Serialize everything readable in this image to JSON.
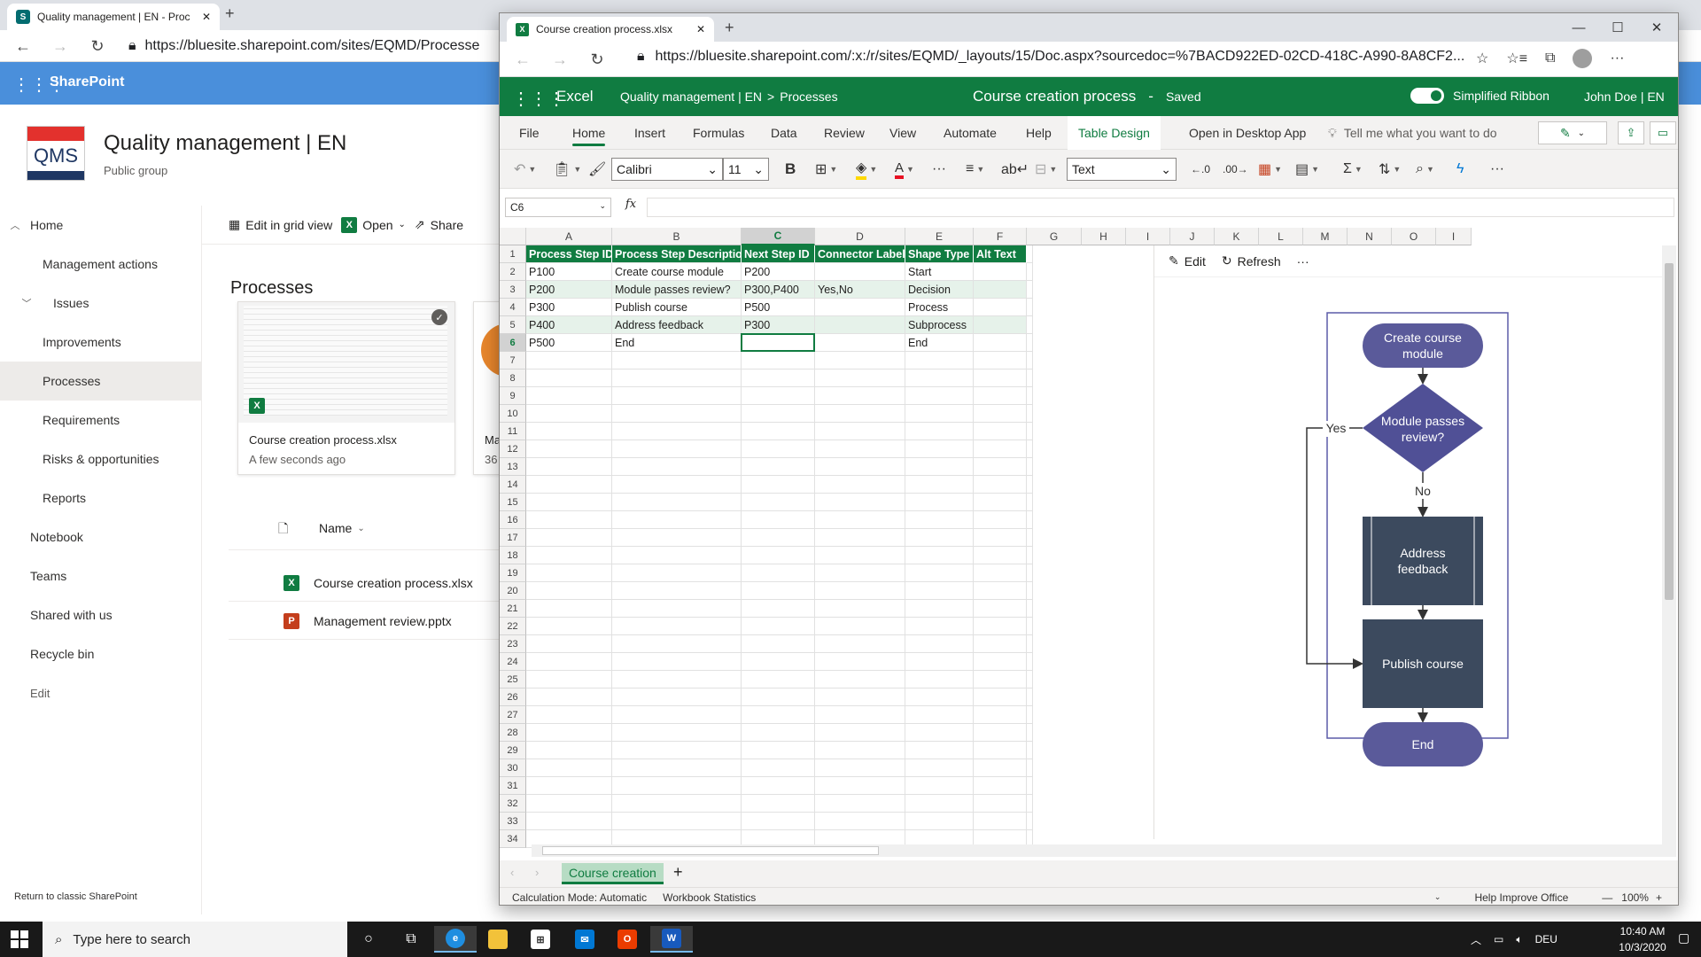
{
  "bg_browser": {
    "tab_title": "Quality management | EN - Proc",
    "url": "https://bluesite.sharepoint.com/sites/EQMD/Processe"
  },
  "sharepoint": {
    "brand": "SharePoint",
    "logo_text": "QMS",
    "site_title": "Quality management | EN",
    "site_subtitle": "Public group",
    "nav": [
      {
        "label": "Home"
      },
      {
        "label": "Management actions"
      },
      {
        "label": "Issues"
      },
      {
        "label": "Improvements"
      },
      {
        "label": "Processes"
      },
      {
        "label": "Requirements"
      },
      {
        "label": "Risks & opportunities"
      },
      {
        "label": "Reports"
      },
      {
        "label": "Notebook"
      },
      {
        "label": "Teams"
      },
      {
        "label": "Shared with us"
      },
      {
        "label": "Recycle bin"
      },
      {
        "label": "Edit"
      }
    ],
    "return_link": "Return to classic SharePoint",
    "commands": {
      "grid": "Edit in grid view",
      "open": "Open",
      "share": "Share"
    },
    "library_title": "Processes",
    "card1": {
      "name": "Course creation process.xlsx",
      "meta": "A few seconds ago"
    },
    "card2": {
      "name": "Ma",
      "meta": "36"
    },
    "list_header": "Name",
    "files": [
      {
        "name": "Course creation process.xlsx"
      },
      {
        "name": "Management review.pptx"
      }
    ]
  },
  "excel_browser": {
    "tab_title": "Course creation process.xlsx",
    "url": "https://bluesite.sharepoint.com/:x:/r/sites/EQMD/_layouts/15/Doc.aspx?sourcedoc=%7BACD922ED-02CD-418C-A990-8A8CF2..."
  },
  "excel": {
    "app": "Excel",
    "breadcrumb_site": "Quality management | EN",
    "breadcrumb_sep": ">",
    "breadcrumb_folder": "Processes",
    "doc_title": "Course creation process",
    "doc_sep": "-",
    "doc_status": "Saved",
    "simplified_ribbon": "Simplified Ribbon",
    "user": "John Doe | EN",
    "menu": {
      "file": "File",
      "home": "Home",
      "insert": "Insert",
      "formulas": "Formulas",
      "data": "Data",
      "review": "Review",
      "view": "View",
      "automate": "Automate",
      "help": "Help",
      "table_design": "Table Design",
      "open_desktop": "Open in Desktop App",
      "tell_me": "Tell me what you want to do"
    },
    "ribbon": {
      "font": "Calibri",
      "size": "11",
      "format": "Text"
    },
    "name_box": "C6",
    "fx": "fx",
    "columns": [
      "A",
      "B",
      "C",
      "D",
      "E",
      "F",
      "G",
      "H",
      "I",
      "J",
      "K",
      "L",
      "M",
      "N",
      "O",
      "I"
    ],
    "selected_column": "C",
    "selected_row": "6",
    "rows": [
      "1",
      "2",
      "3",
      "4",
      "5",
      "6",
      "7",
      "8",
      "9",
      "10",
      "11",
      "12",
      "13",
      "14",
      "15",
      "16",
      "17",
      "18",
      "19",
      "20",
      "21",
      "22",
      "23",
      "24",
      "25",
      "26",
      "27",
      "28",
      "29",
      "30",
      "31",
      "32",
      "33",
      "34"
    ],
    "table": {
      "headers": [
        "Process Step ID",
        "Process Step Description",
        "Next Step ID",
        "Connector Label",
        "Shape Type",
        "Alt Text"
      ],
      "rows": [
        [
          "P100",
          "Create course module",
          "P200",
          "",
          "Start",
          ""
        ],
        [
          "P200",
          "Module passes review?",
          "P300,P400",
          "Yes,No",
          "Decision",
          ""
        ],
        [
          "P300",
          "Publish course",
          "P500",
          "",
          "Process",
          ""
        ],
        [
          "P400",
          "Address feedback",
          "P300",
          "",
          "Subprocess",
          ""
        ],
        [
          "P500",
          "End",
          "",
          "",
          "End",
          ""
        ]
      ]
    },
    "pane": {
      "edit": "Edit",
      "refresh": "Refresh",
      "more": "···"
    },
    "diagram": {
      "start": [
        "Create course",
        "module"
      ],
      "decision": [
        "Module passes",
        "review?"
      ],
      "subprocess": [
        "Address",
        "feedback"
      ],
      "process": "Publish course",
      "end": "End",
      "label_yes": "Yes",
      "label_no": "No",
      "colors": {
        "terminal": "#5a5a9a",
        "decision": "#505096",
        "box": "#3c4a5e",
        "frame": "#5c5ca8"
      }
    },
    "sheet_tab": "Course creation",
    "status": {
      "calc": "Calculation Mode: Automatic",
      "stats": "Workbook Statistics",
      "help": "Help Improve Office",
      "zoom": "100%"
    }
  },
  "taskbar": {
    "search_placeholder": "Type here to search",
    "lang": "DEU",
    "time": "10:40 AM",
    "date": "10/3/2020"
  }
}
